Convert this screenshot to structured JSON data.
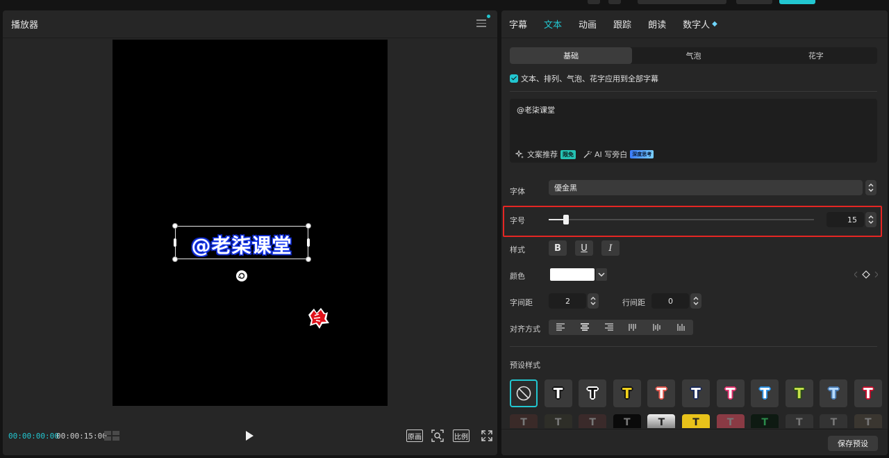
{
  "player": {
    "title": "播放器",
    "caption": "@老柒课堂",
    "timecode_current": "00:00:00:00",
    "timecode_total": "00:00:15:00",
    "btn_original": "原画",
    "btn_ratio": "比例"
  },
  "tabs": [
    {
      "label": "字幕",
      "active": false
    },
    {
      "label": "文本",
      "active": true
    },
    {
      "label": "动画",
      "active": false
    },
    {
      "label": "跟踪",
      "active": false
    },
    {
      "label": "朗读",
      "active": false
    },
    {
      "label": "数字人",
      "active": false
    }
  ],
  "segments": [
    "基础",
    "气泡",
    "花字"
  ],
  "apply_all_label": "文本、排列、气泡、花字应用到全部字幕",
  "text_input": {
    "value": "@老柒课堂",
    "tool1": "文案推荐",
    "tool1_badge": "限免",
    "tool2": "AI 写旁白",
    "tool2_badge": "深度思考"
  },
  "font": {
    "label": "字体",
    "value": "優金黑"
  },
  "font_size": {
    "label": "字号",
    "value": "15",
    "slider_fraction": 0.04
  },
  "style": {
    "label": "样式",
    "bold": "B",
    "underline": "U",
    "italic": "I"
  },
  "color": {
    "label": "颜色",
    "value": "#ffffff"
  },
  "letter_spacing": {
    "label": "字间距",
    "value": "2"
  },
  "line_spacing": {
    "label": "行间距",
    "value": "0"
  },
  "align_label": "对齐方式",
  "presets_label": "预设样式",
  "presets_row1": [
    {
      "glyph": "T",
      "color": "#ffffff",
      "stroke": "#111111"
    },
    {
      "glyph": "T",
      "color": "#111111",
      "stroke": "#ffffff"
    },
    {
      "glyph": "T",
      "color": "#f2d21b",
      "stroke": "#111111"
    },
    {
      "glyph": "T",
      "color": "#ffffff",
      "stroke": "#e0574d"
    },
    {
      "glyph": "T",
      "color": "#ffffff",
      "stroke": "#1a2a5a"
    },
    {
      "glyph": "T",
      "color": "#ffffff",
      "stroke": "#e0336e"
    },
    {
      "glyph": "T",
      "color": "#ffffff",
      "stroke": "#2c8fe0"
    },
    {
      "glyph": "T",
      "color": "#c6e04a",
      "stroke": "#2b4a1a"
    },
    {
      "glyph": "T",
      "color": "#b8dcff",
      "stroke": "#4a7ab0"
    },
    {
      "glyph": "T",
      "color": "#ffffff",
      "stroke": "#c8102e"
    }
  ],
  "save_preset": "保存预设",
  "colors": {
    "accent": "#22c6d0",
    "highlight": "#e52623"
  }
}
